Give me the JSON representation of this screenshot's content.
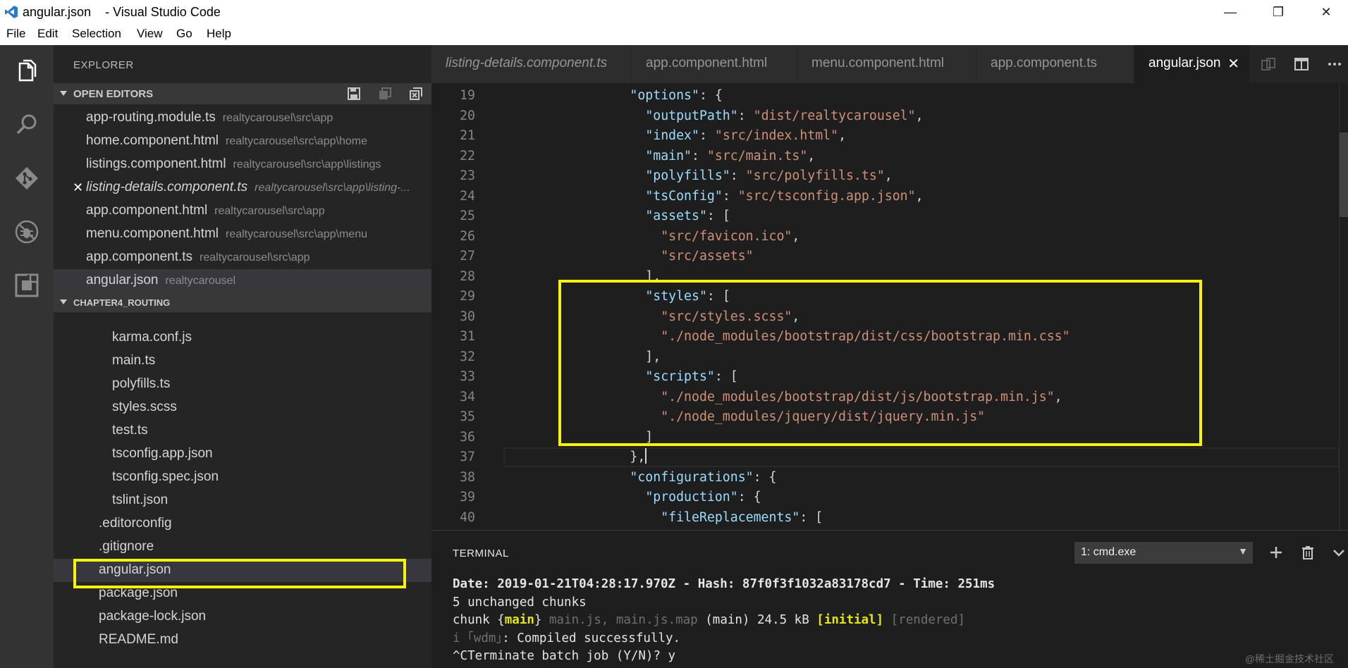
{
  "window": {
    "title": "angular.json    - Visual Studio Code",
    "controls": [
      "—",
      "❐",
      "✕"
    ]
  },
  "menu": [
    "File",
    "Edit",
    "Selection",
    "View",
    "Go",
    "Help"
  ],
  "activity_bar": [
    "files-icon",
    "search-icon",
    "source-control-icon",
    "debug-icon",
    "extensions-icon"
  ],
  "sidebar": {
    "title": "EXPLORER",
    "open_editors": {
      "label": "OPEN EDITORS",
      "actions": [
        "save-all-icon",
        "close-all-icon",
        "collapse-icon"
      ],
      "items": [
        {
          "name": "app-routing.module.ts",
          "path": "realtycarousel\\src\\app"
        },
        {
          "name": "home.component.html",
          "path": "realtycarousel\\src\\app\\home"
        },
        {
          "name": "listings.component.html",
          "path": "realtycarousel\\src\\app\\listings"
        },
        {
          "name": "listing-details.component.ts",
          "path": "realtycarousel\\src\\app\\listing-..."
        },
        {
          "name": "app.component.html",
          "path": "realtycarousel\\src\\app"
        },
        {
          "name": "menu.component.html",
          "path": "realtycarousel\\src\\app\\menu"
        },
        {
          "name": "app.component.ts",
          "path": "realtycarousel\\src\\app"
        },
        {
          "name": "angular.json",
          "path": "realtycarousel"
        }
      ]
    },
    "project": {
      "label": "CHAPTER4_ROUTING",
      "files_nested": [
        "karma.conf.js",
        "main.ts",
        "polyfills.ts",
        "styles.scss",
        "test.ts",
        "tsconfig.app.json",
        "tsconfig.spec.json",
        "tslint.json"
      ],
      "files_root": [
        ".editorconfig",
        ".gitignore",
        "angular.json",
        "package.json",
        "package-lock.json",
        "README.md"
      ]
    }
  },
  "tabs": [
    {
      "label": "listing-details.component.ts"
    },
    {
      "label": "app.component.html"
    },
    {
      "label": "menu.component.html"
    },
    {
      "label": "app.component.ts"
    },
    {
      "label": "angular.json",
      "close": "✕"
    }
  ],
  "editor": {
    "lines": [
      {
        "n": "19",
        "t": [
          [
            "            ",
            "p"
          ],
          [
            "\"options\"",
            "k"
          ],
          [
            ": {",
            "p"
          ]
        ]
      },
      {
        "n": "20",
        "t": [
          [
            "              ",
            "p"
          ],
          [
            "\"outputPath\"",
            "k"
          ],
          [
            ": ",
            "p"
          ],
          [
            "\"dist/realtycarousel\"",
            "s"
          ],
          [
            ",",
            "p"
          ]
        ]
      },
      {
        "n": "21",
        "t": [
          [
            "              ",
            "p"
          ],
          [
            "\"index\"",
            "k"
          ],
          [
            ": ",
            "p"
          ],
          [
            "\"src/index.html\"",
            "s"
          ],
          [
            ",",
            "p"
          ]
        ]
      },
      {
        "n": "22",
        "t": [
          [
            "              ",
            "p"
          ],
          [
            "\"main\"",
            "k"
          ],
          [
            ": ",
            "p"
          ],
          [
            "\"src/main.ts\"",
            "s"
          ],
          [
            ",",
            "p"
          ]
        ]
      },
      {
        "n": "23",
        "t": [
          [
            "              ",
            "p"
          ],
          [
            "\"polyfills\"",
            "k"
          ],
          [
            ": ",
            "p"
          ],
          [
            "\"src/polyfills.ts\"",
            "s"
          ],
          [
            ",",
            "p"
          ]
        ]
      },
      {
        "n": "24",
        "t": [
          [
            "              ",
            "p"
          ],
          [
            "\"tsConfig\"",
            "k"
          ],
          [
            ": ",
            "p"
          ],
          [
            "\"src/tsconfig.app.json\"",
            "s"
          ],
          [
            ",",
            "p"
          ]
        ]
      },
      {
        "n": "25",
        "t": [
          [
            "              ",
            "p"
          ],
          [
            "\"assets\"",
            "k"
          ],
          [
            ": [",
            "p"
          ]
        ]
      },
      {
        "n": "26",
        "t": [
          [
            "                ",
            "p"
          ],
          [
            "\"src/favicon.ico\"",
            "s"
          ],
          [
            ",",
            "p"
          ]
        ]
      },
      {
        "n": "27",
        "t": [
          [
            "                ",
            "p"
          ],
          [
            "\"src/assets\"",
            "s"
          ]
        ]
      },
      {
        "n": "28",
        "t": [
          [
            "              ],",
            "p"
          ]
        ]
      },
      {
        "n": "29",
        "t": [
          [
            "              ",
            "p"
          ],
          [
            "\"styles\"",
            "k"
          ],
          [
            ": [",
            "p"
          ]
        ]
      },
      {
        "n": "30",
        "t": [
          [
            "                ",
            "p"
          ],
          [
            "\"src/styles.scss\"",
            "s"
          ],
          [
            ",",
            "p"
          ]
        ]
      },
      {
        "n": "31",
        "t": [
          [
            "                ",
            "p"
          ],
          [
            "\"./node_modules/bootstrap/dist/css/bootstrap.min.css\"",
            "s"
          ]
        ]
      },
      {
        "n": "32",
        "t": [
          [
            "              ],",
            "p"
          ]
        ]
      },
      {
        "n": "33",
        "t": [
          [
            "              ",
            "p"
          ],
          [
            "\"scripts\"",
            "k"
          ],
          [
            ": [",
            "p"
          ]
        ]
      },
      {
        "n": "34",
        "t": [
          [
            "                ",
            "p"
          ],
          [
            "\"./node_modules/bootstrap/dist/js/bootstrap.min.js\"",
            "s"
          ],
          [
            ",",
            "p"
          ]
        ]
      },
      {
        "n": "35",
        "t": [
          [
            "                ",
            "p"
          ],
          [
            "\"./node_modules/jquery/dist/jquery.min.js\"",
            "s"
          ]
        ]
      },
      {
        "n": "36",
        "t": [
          [
            "              ]",
            "p"
          ]
        ]
      },
      {
        "n": "37",
        "t": [
          [
            "            },",
            "p"
          ]
        ],
        "cursor": true
      },
      {
        "n": "38",
        "t": [
          [
            "            ",
            "p"
          ],
          [
            "\"configurations\"",
            "k"
          ],
          [
            ": {",
            "p"
          ]
        ]
      },
      {
        "n": "39",
        "t": [
          [
            "              ",
            "p"
          ],
          [
            "\"production\"",
            "k"
          ],
          [
            ": {",
            "p"
          ]
        ]
      },
      {
        "n": "40",
        "t": [
          [
            "                ",
            "p"
          ],
          [
            "\"fileReplacements\"",
            "k"
          ],
          [
            ": [",
            "p"
          ]
        ]
      }
    ]
  },
  "panel": {
    "title": "TERMINAL",
    "terminal_select": "1: cmd.exe",
    "actions": [
      "add-terminal-icon",
      "trash-icon",
      "chevron-down-icon"
    ],
    "lines": [
      [
        [
          "Date: ",
          "b"
        ],
        [
          "2019-01-21T04:28:17.970Z",
          "b"
        ],
        [
          " - Hash: ",
          "b"
        ],
        [
          "87f0f3f1032a83178cd7",
          "b"
        ],
        [
          " - Time: ",
          "b"
        ],
        [
          "251ms",
          "b"
        ]
      ],
      [
        [
          "5 unchanged chunks",
          "n"
        ]
      ],
      [
        [
          "chunk {",
          "n"
        ],
        [
          "main",
          "y"
        ],
        [
          "} ",
          "n"
        ],
        [
          "main.js, main.js.map",
          "d"
        ],
        [
          " (main) 24.5 kB ",
          "n"
        ],
        [
          "[initial]",
          "y"
        ],
        [
          " ",
          "n"
        ],
        [
          "[rendered]",
          "d"
        ]
      ],
      [
        [
          "i ",
          "d"
        ],
        [
          "｢wdm｣",
          "d"
        ],
        [
          ": Compiled successfully.",
          "n"
        ]
      ],
      [
        [
          "^CTerminate batch job (Y/N)? y",
          "n"
        ]
      ]
    ],
    "watermark": "@稀土掘金技术社区"
  },
  "colors": {
    "highlight": "#f8f30c",
    "key": "#9cdcfe",
    "string": "#ce9178"
  }
}
